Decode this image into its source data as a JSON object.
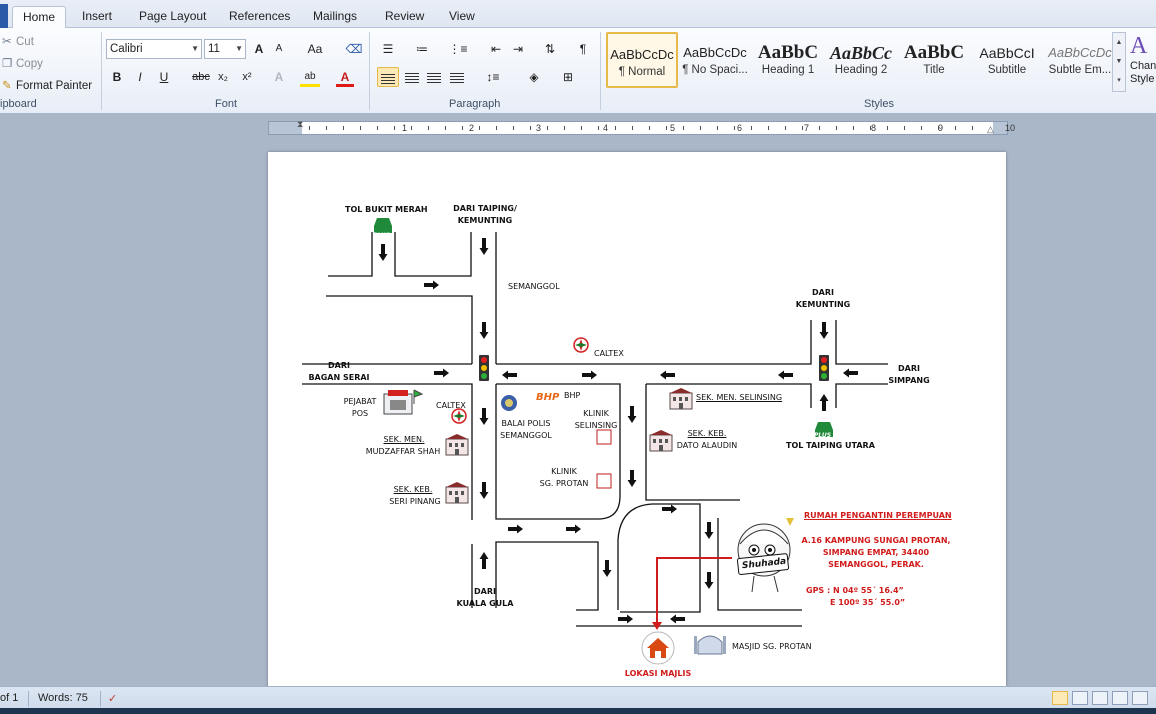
{
  "tabs": [
    "Home",
    "Insert",
    "Page Layout",
    "References",
    "Mailings",
    "Review",
    "View"
  ],
  "clipboard": {
    "cut": "Cut",
    "copy": "Copy",
    "format_painter": "Format Painter",
    "label": "ipboard"
  },
  "font": {
    "name": "Calibri",
    "size": "11",
    "label": "Font",
    "grow": "A",
    "shrink": "A",
    "case": "Aa",
    "bold": "B",
    "italic": "I",
    "underline": "U",
    "strike": "abc",
    "sub": "x₂",
    "sup": "x²",
    "fontcolor": "A"
  },
  "paragraph": {
    "label": "Paragraph",
    "pilcrow": "¶"
  },
  "styles": {
    "label": "Styles",
    "items": [
      {
        "preview": "AaBbCcDc",
        "name": "¶ Normal"
      },
      {
        "preview": "AaBbCcDc",
        "name": "¶ No Spaci..."
      },
      {
        "preview": "AaBbC",
        "name": "Heading 1"
      },
      {
        "preview": "AaBbCc",
        "name": "Heading 2"
      },
      {
        "preview": "AaBbC",
        "name": "Title"
      },
      {
        "preview": "AaBbCcI",
        "name": "Subtitle"
      },
      {
        "preview": "AaBbCcDc",
        "name": "Subtle Em..."
      }
    ],
    "change_styles": "Chan Style"
  },
  "ruler": [
    "1",
    "2",
    "3",
    "4",
    "5",
    "6",
    "7",
    "8",
    "9",
    "10"
  ],
  "map": {
    "tol_bukit_merah": "TOL BUKIT MERAH",
    "dari_taiping_1": "DARI TAIPING/",
    "dari_taiping_2": "KEMUNTING",
    "semanggol": "SEMANGGOL",
    "dari_kemunting_1": "DARI",
    "dari_kemunting_2": "KEMUNTING",
    "caltex_top": "CALTEX",
    "dari_bagan_1": "DARI",
    "dari_bagan_2": "BAGAN SERAI",
    "dari_simpang_1": "DARI",
    "dari_simpang_2": "SIMPANG",
    "pejabat_pos_1": "PEJABAT",
    "pejabat_pos_2": "POS",
    "caltex_left": "CALTEX",
    "bhp": "BHP",
    "balai_1": "BALAI  POLIS",
    "balai_2": "SEMANGGOL",
    "klinik_selinsing_1": "KLINIK",
    "klinik_selinsing_2": "SELINSING",
    "sek_men_selinsing": "SEK. MEN. SELINSING",
    "sek_keb_dato_1": "SEK. KEB.",
    "sek_keb_dato_2": "DATO ALAUDIN",
    "tol_taiping_utara": "TOL TAIPING UTARA",
    "sek_men_mudzaffar_1": "SEK. MEN.",
    "sek_men_mudzaffar_2": "MUDZAFFAR SHAH",
    "klinik_protan_1": "KLINIK",
    "klinik_protan_2": "SG. PROTAN",
    "sek_keb_seri_1": "SEK. KEB.",
    "sek_keb_seri_2": "SERI PINANG",
    "rumah_title": "RUMAH PENGANTIN  PEREMPUAN",
    "addr_1": "A.16 KAMPUNG SUNGAI PROTAN,",
    "addr_2": "SIMPANG EMPAT, 34400",
    "addr_3": "SEMANGGOL, PERAK.",
    "gps_1": "GPS :  N   04º 55´ 16.4”",
    "gps_2": "E 100º 35´ 55.0”",
    "dari_kuala_1": "DARI",
    "dari_kuala_2": "KUALA GULA",
    "masjid": "MASJID SG. PROTAN",
    "lokasi": "LOKASI MAJLIS",
    "plus": "PLUS",
    "shuhada": "Shuhada"
  },
  "status": {
    "page": "of 1",
    "words": "Words: 75"
  }
}
